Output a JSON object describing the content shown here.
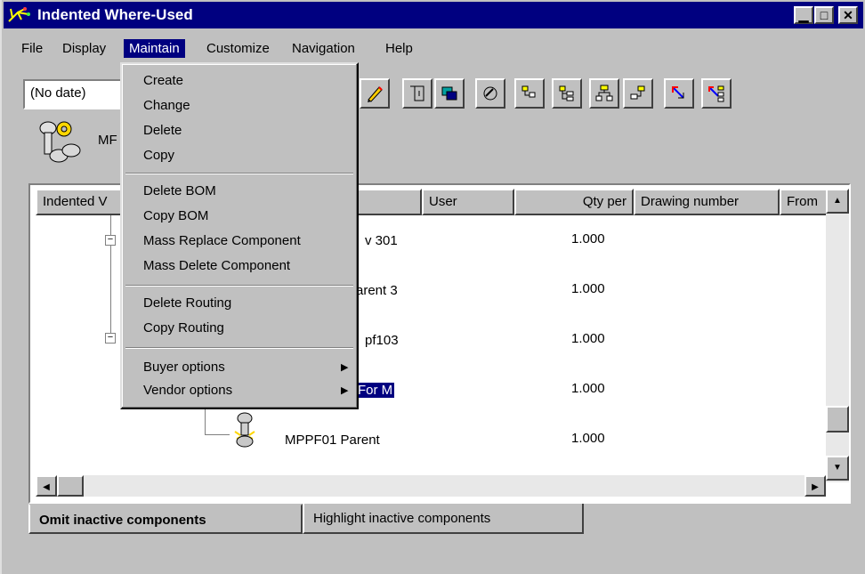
{
  "window": {
    "title": "Indented Where-Used",
    "minimize": "▁",
    "maximize": "□",
    "close": "✕"
  },
  "menubar": {
    "items": [
      "File",
      "Display",
      "Maintain",
      "Customize",
      "Navigation",
      "Help"
    ]
  },
  "toolbar": {
    "date_value": "(No date)"
  },
  "part": {
    "label": "MF"
  },
  "grid": {
    "columns": [
      "Indented V",
      "User",
      "Qty per",
      "Drawing number",
      "From"
    ],
    "rows": [
      {
        "text": "v 301",
        "qty": "1.000"
      },
      {
        "text": "arent 3",
        "qty": "1.000"
      },
      {
        "text": "pf103",
        "qty": "1.000"
      },
      {
        "text": "For M",
        "qty": "1.000"
      },
      {
        "text": "MPPF01   Parent",
        "qty": "1.000"
      }
    ]
  },
  "tabs": {
    "omit": "Omit inactive components",
    "highlight": "Highlight inactive components"
  },
  "dropdown": {
    "group1": [
      "Create",
      "Change",
      "Delete",
      "Copy"
    ],
    "group2": [
      "Delete BOM",
      "Copy BOM",
      "Mass Replace Component",
      "Mass Delete Component"
    ],
    "group3": [
      "Delete Routing",
      "Copy Routing"
    ],
    "group4": [
      "Buyer options",
      "Vendor options"
    ],
    "submenu_arrow": "▶"
  },
  "colors": {
    "titlebar": "#000080",
    "selection": "#000080",
    "face": "#c0c0c0"
  }
}
